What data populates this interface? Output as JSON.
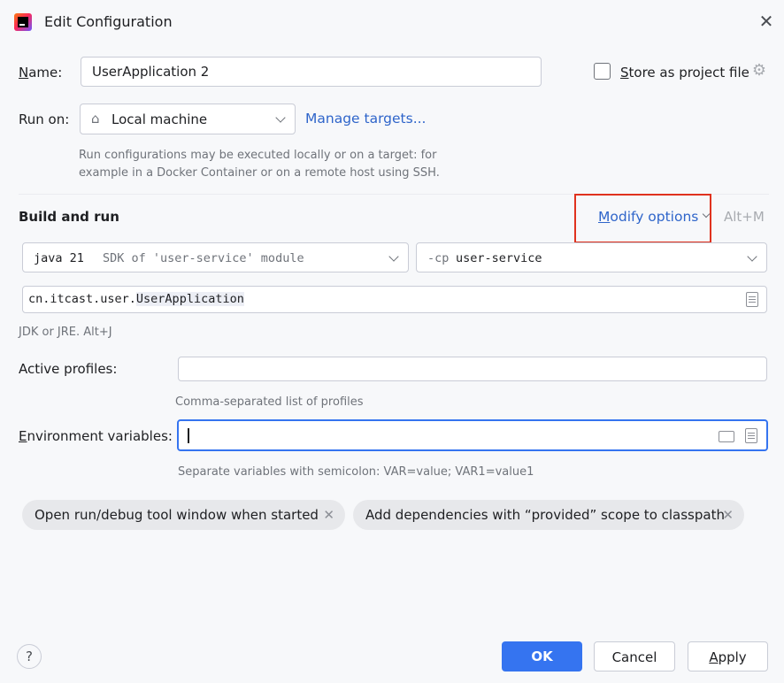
{
  "window": {
    "title": "Edit Configuration"
  },
  "name": {
    "label_u": "N",
    "label_rest": "ame:",
    "value": "UserApplication 2"
  },
  "store": {
    "label_u": "S",
    "label_rest": "tore as project file"
  },
  "run_on": {
    "label": "Run on:",
    "value": "Local machine",
    "manage": "Manage targets...",
    "hint1": "Run configurations may be executed locally or on a target: for",
    "hint2": "example in a Docker Container or on a remote host using SSH."
  },
  "build": {
    "title": "Build and run",
    "modify_u": "M",
    "modify_rest": "odify options",
    "shortcut": "Alt+M"
  },
  "jdk": {
    "name": "java 21",
    "desc": "SDK of 'user-service' module"
  },
  "cp": {
    "flag": "-cp",
    "value": "user-service"
  },
  "main_class": {
    "pkg": "cn.itcast.user.",
    "cls": "UserApplication"
  },
  "jdk_hint": "JDK or JRE. Alt+J",
  "profiles": {
    "label": "Active profiles:",
    "value": "",
    "hint": "Comma-separated list of profiles"
  },
  "env": {
    "label_u": "E",
    "label_rest": "nvironment variables:",
    "value": "",
    "hint": "Separate variables with semicolon: VAR=value; VAR1=value1"
  },
  "chips": [
    "Open run/debug tool window when started",
    "Add dependencies with “provided” scope to classpath"
  ],
  "buttons": {
    "ok": "OK",
    "cancel": "Cancel",
    "apply_u": "A",
    "apply_rest": "pply",
    "help": "?"
  },
  "colors": {
    "accent": "#3574f0",
    "link": "#2f65ca",
    "highlight_box": "#e0321e"
  }
}
